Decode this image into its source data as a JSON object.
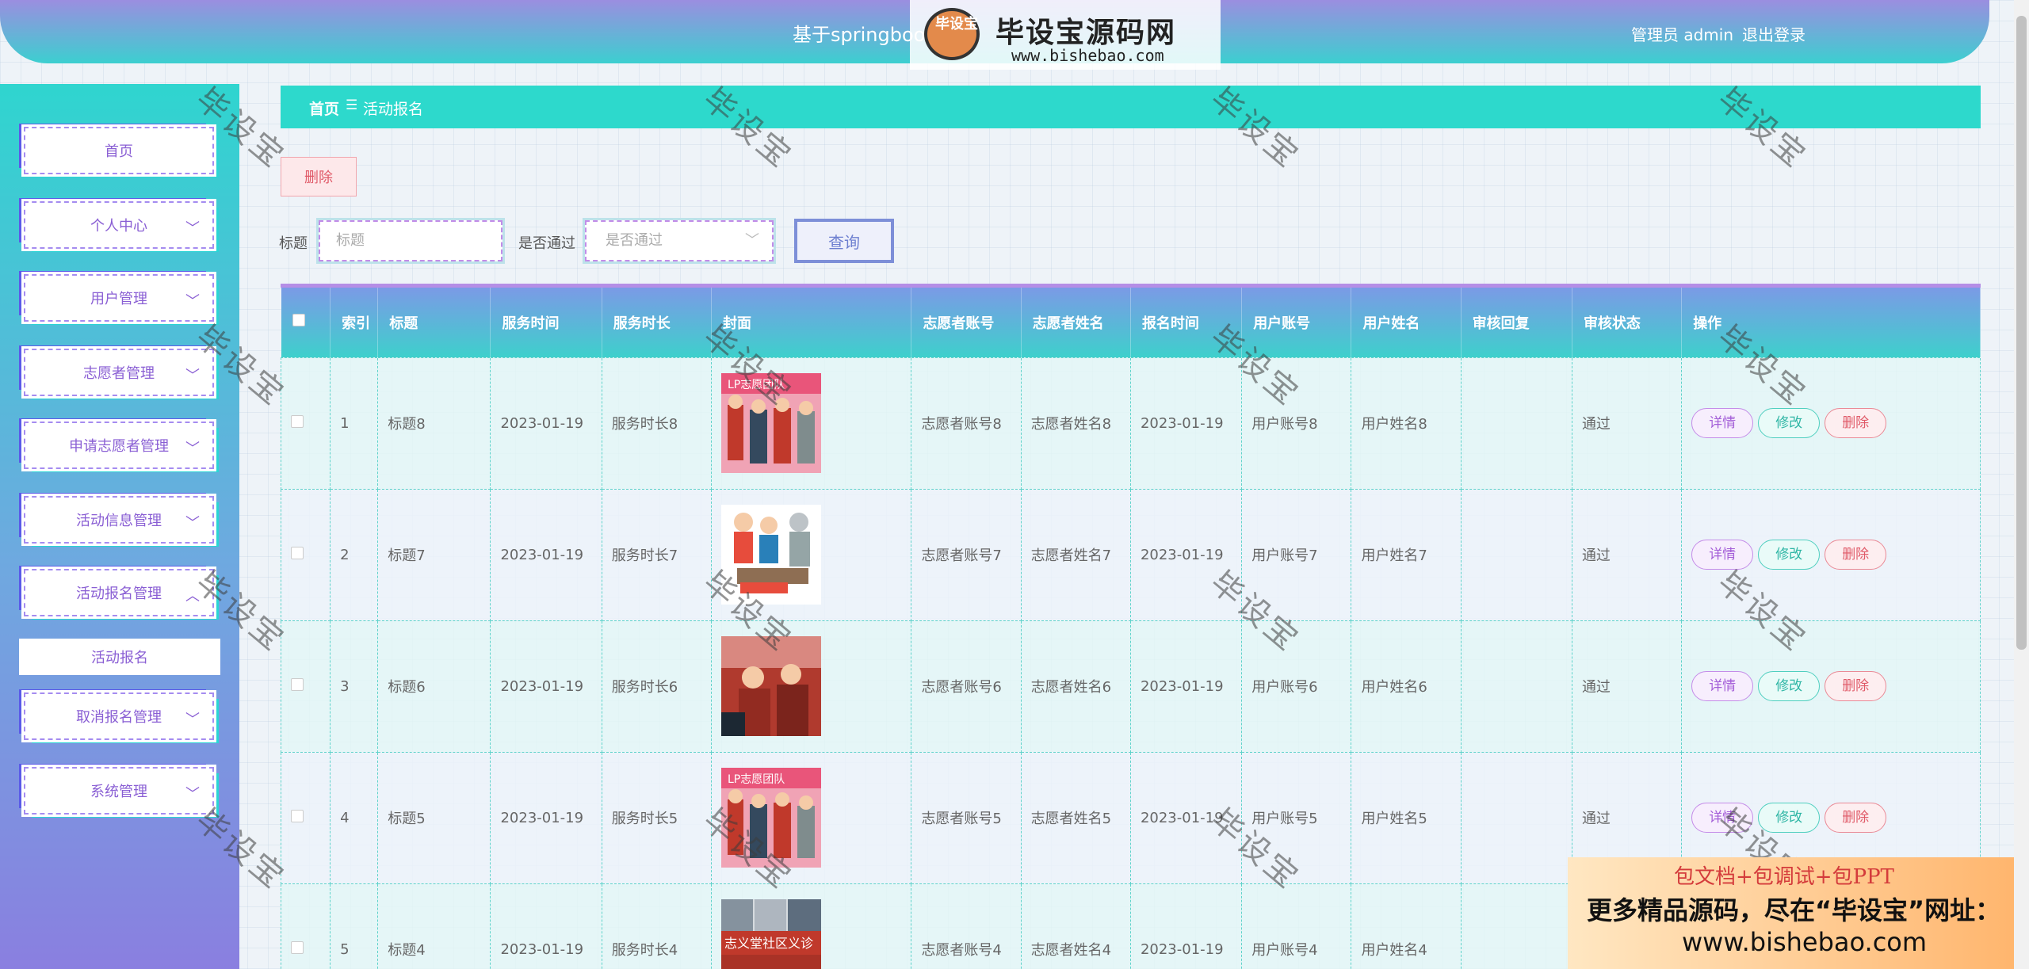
{
  "header": {
    "title": "基于springboo",
    "user": "管理员 admin",
    "logout": "退出登录"
  },
  "watermark_logo": {
    "icon_text": "毕设宝",
    "name": "毕设宝源码网",
    "url": "www.bishebao.com"
  },
  "sidebar": {
    "items": [
      {
        "label": "首页",
        "chevron": ""
      },
      {
        "label": "个人中心",
        "chevron": "﹀"
      },
      {
        "label": "用户管理",
        "chevron": "﹀"
      },
      {
        "label": "志愿者管理",
        "chevron": "﹀"
      },
      {
        "label": "申请志愿者管理",
        "chevron": "﹀"
      },
      {
        "label": "活动信息管理",
        "chevron": "﹀"
      },
      {
        "label": "活动报名管理",
        "chevron": "︿"
      },
      {
        "label": "取消报名管理",
        "chevron": "﹀"
      },
      {
        "label": "系统管理",
        "chevron": "﹀"
      }
    ],
    "subitem": "活动报名"
  },
  "breadcrumb": {
    "home": "首页",
    "sep": "☰",
    "current": "活动报名"
  },
  "toolbar": {
    "delete": "删除"
  },
  "search": {
    "title_label": "标题",
    "title_placeholder": "标题",
    "pass_label": "是否通过",
    "pass_placeholder": "是否通过",
    "query": "查询"
  },
  "table": {
    "headers": [
      "",
      "索引",
      "标题",
      "服务时间",
      "服务时长",
      "封面",
      "志愿者账号",
      "志愿者姓名",
      "报名时间",
      "用户账号",
      "用户姓名",
      "审核回复",
      "审核状态",
      "操作"
    ],
    "rows": [
      {
        "index": "1",
        "title": "标题8",
        "service_time": "2023-01-19",
        "duration": "服务时长8",
        "cover": "cover-photo-volunteer-team-banner",
        "vol_account": "志愿者账号8",
        "vol_name": "志愿者姓名8",
        "signup_time": "2023-01-19",
        "user_account": "用户账号8",
        "user_name": "用户姓名8",
        "reply": "",
        "status": "通过"
      },
      {
        "index": "2",
        "title": "标题7",
        "service_time": "2023-01-19",
        "duration": "服务时长7",
        "cover": "cover-illustration-volunteers",
        "vol_account": "志愿者账号7",
        "vol_name": "志愿者姓名7",
        "signup_time": "2023-01-19",
        "user_account": "用户账号7",
        "user_name": "用户姓名7",
        "reply": "",
        "status": "通过"
      },
      {
        "index": "3",
        "title": "标题6",
        "service_time": "2023-01-19",
        "duration": "服务时长6",
        "cover": "cover-photo-volunteers-red",
        "vol_account": "志愿者账号6",
        "vol_name": "志愿者姓名6",
        "signup_time": "2023-01-19",
        "user_account": "用户账号6",
        "user_name": "用户姓名6",
        "reply": "",
        "status": "通过"
      },
      {
        "index": "4",
        "title": "标题5",
        "service_time": "2023-01-19",
        "duration": "服务时长5",
        "cover": "cover-photo-volunteer-team-banner",
        "vol_account": "志愿者账号5",
        "vol_name": "志愿者姓名5",
        "signup_time": "2023-01-19",
        "user_account": "用户账号5",
        "user_name": "用户姓名5",
        "reply": "",
        "status": "通过"
      },
      {
        "index": "5",
        "title": "标题4",
        "service_time": "2023-01-19",
        "duration": "服务时长4",
        "cover": "cover-photo-clinic-banner",
        "vol_account": "志愿者账号4",
        "vol_name": "志愿者姓名4",
        "signup_time": "2023-01-19",
        "user_account": "用户账号4",
        "user_name": "用户姓名4",
        "reply": "",
        "status": ""
      }
    ],
    "ops": {
      "detail": "详情",
      "edit": "修改",
      "delete": "删除"
    }
  },
  "watermark_text": "毕设宝",
  "promo": {
    "line1": "包文档+包调试+包PPT",
    "line2": "更多精品源码，尽在“毕设宝”网址：",
    "line3": "www.bishebao.com"
  },
  "colors": {
    "header_gradient": [
      "#9b8ee0",
      "#3ccfd0"
    ],
    "sidebar_gradient": [
      "#2fd5cf",
      "#8a7fe0"
    ],
    "breadcrumb": "#2dd9cc",
    "accent_purple": "#8a5fd4"
  }
}
